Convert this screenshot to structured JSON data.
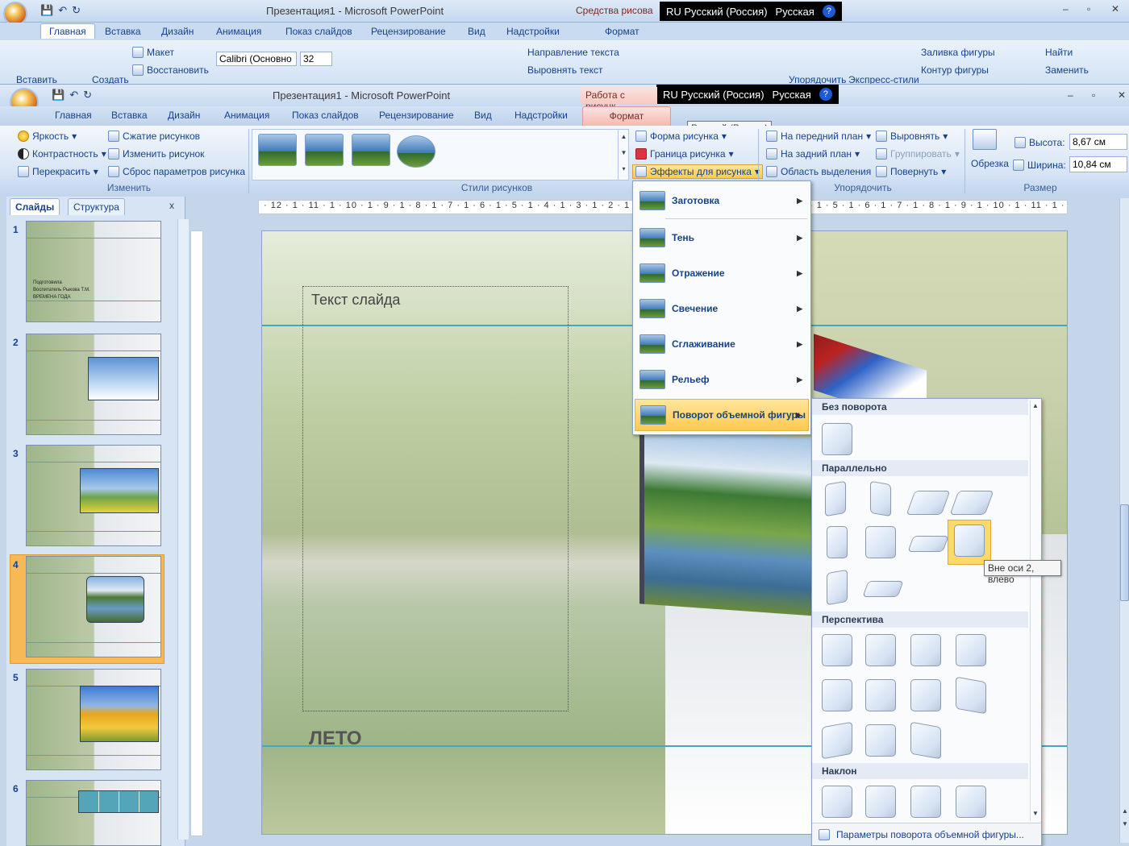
{
  "back_window": {
    "title": "Презентация1 - Microsoft PowerPoint",
    "context_tab": "Средства рисова",
    "tabs": [
      "Главная",
      "Вставка",
      "Дизайн",
      "Анимация",
      "Показ слайдов",
      "Рецензирование",
      "Вид",
      "Надстройки",
      "Формат"
    ],
    "lang_bar": {
      "lang": "RU Русский (Россия)",
      "keyboard": "Русская",
      "help": "?"
    },
    "ribbon": {
      "paste": "Вставить",
      "create": "Создать",
      "layout": "Макет",
      "restore": "Восстановить",
      "font": "Calibri (Основно",
      "size": "32",
      "text_dir": "Направление текста",
      "align_text": "Выровнять текст",
      "arrange": "Упорядочить",
      "quick_styles": "Экспресс-стили",
      "fill": "Заливка фигуры",
      "outline": "Контур фигуры",
      "find": "Найти",
      "replace": "Заменить"
    }
  },
  "front_window": {
    "title": "Презентация1 - Microsoft PowerPoint",
    "context_tab": "Работа с рисунк",
    "tabs": [
      "Главная",
      "Вставка",
      "Дизайн",
      "Анимация",
      "Показ слайдов",
      "Рецензирование",
      "Вид",
      "Надстройки"
    ],
    "format_tab": "Формат",
    "lang_bar": {
      "lang": "RU Русский (Россия)",
      "keyboard": "Русская",
      "help": "?"
    },
    "lang_tooltip": "Русский (Россия)",
    "ribbon": {
      "adjust": {
        "label": "Изменить",
        "brightness": "Яркость",
        "contrast": "Контрастность",
        "recolor": "Перекрасить",
        "compress": "Сжатие рисунков",
        "change": "Изменить рисунок",
        "reset": "Сброс параметров рисунка"
      },
      "styles": {
        "label": "Стили рисунков",
        "shape": "Форма рисунка",
        "border": "Граница рисунка",
        "effects": "Эффекты для рисунка"
      },
      "arrange": {
        "label": "Упорядочить",
        "front": "На передний план",
        "back": "На задний план",
        "selection": "Область выделения",
        "align": "Выровнять",
        "group": "Группировать",
        "rotate": "Повернуть"
      },
      "size": {
        "label": "Размер",
        "crop": "Обрезка",
        "height_label": "Высота:",
        "height": "8,67 см",
        "width_label": "Ширина:",
        "width": "10,84 см"
      }
    }
  },
  "panel": {
    "tab_slides": "Слайды",
    "tab_outline": "Структура",
    "close": "x",
    "slides": [
      {
        "num": "1",
        "lines": [
          "Подготовила",
          "Воспитатель Рыкова Т.М.",
          "ВРЕМЕНА ГОДА"
        ]
      },
      {
        "num": "2"
      },
      {
        "num": "3"
      },
      {
        "num": "4"
      },
      {
        "num": "5"
      },
      {
        "num": "6"
      }
    ]
  },
  "ruler": {
    "h": "· 12 · 1 · 11 · 1 · 10 · 1 · 9 · 1 · 8 · 1 · 7 · 1 · 6 · 1 · 5 · 1 · 4 · 1 · 3 · 1 · 2 · 1 · 1 · 1 · 0 · 1 · 1 · 1 · 2 · 1 · 3 · 1 · 4 · 1 · 5 · 1 · 6 · 1 · 7 · 1 · 8 · 1 · 9 · 1 · 10 · 1 · 11 · 1 · 12 ·"
  },
  "slide": {
    "text": "Текст слайда",
    "title": "ЛЕТО"
  },
  "effects_menu": [
    {
      "label": "Заготовка"
    },
    {
      "label": "Тень"
    },
    {
      "label": "Отражение"
    },
    {
      "label": "Свечение"
    },
    {
      "label": "Сглаживание"
    },
    {
      "label": "Рельеф"
    },
    {
      "label": "Поворот объемной фигуры"
    }
  ],
  "gallery": {
    "no_rotation": "Без поворота",
    "parallel": "Параллельно",
    "perspective": "Перспектива",
    "oblique": "Наклон",
    "footer": "Параметры поворота объемной фигуры...",
    "tooltip": "Вне оси 2, влево"
  }
}
